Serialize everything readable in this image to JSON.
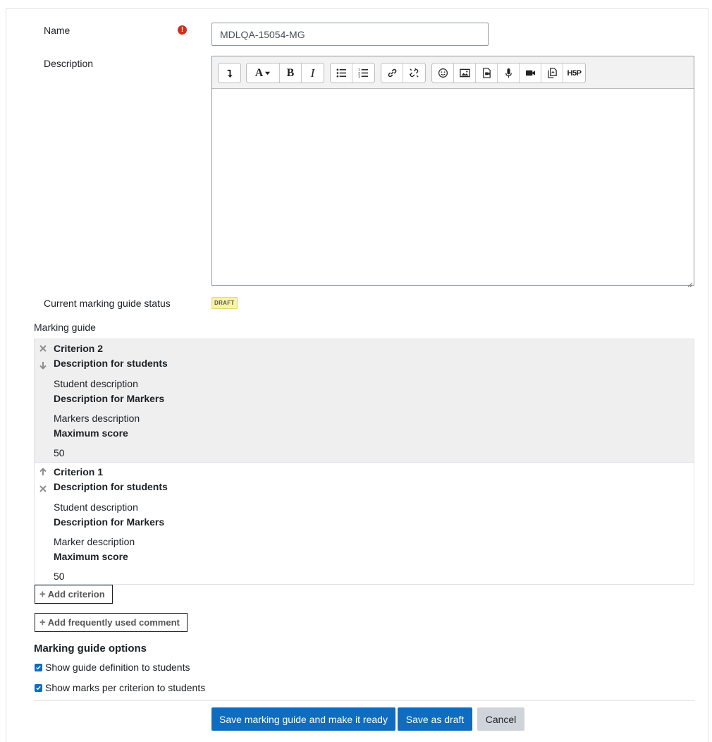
{
  "form": {
    "name_label": "Name",
    "name_value": "MDLQA-15054-MG",
    "description_label": "Description",
    "status_label": "Current marking guide status",
    "status_badge": "DRAFT"
  },
  "editor": {
    "toolbar_groups": [
      [
        "collapse-icon"
      ],
      [
        "font-icon",
        "bold-icon",
        "italic-icon"
      ],
      [
        "unordered-list-icon",
        "ordered-list-icon"
      ],
      [
        "link-icon",
        "unlink-icon"
      ],
      [
        "emoji-icon",
        "image-icon",
        "media-icon",
        "record-audio-icon",
        "record-video-icon",
        "manage-files-icon",
        "h5p-icon"
      ]
    ],
    "bold_glyph": "B",
    "italic_glyph": "I",
    "h5p_label": "H5P"
  },
  "marking_guide": {
    "label": "Marking guide",
    "criteria": [
      {
        "name": "Criterion 2",
        "desc_students_heading": "Description for students",
        "student_description": "Student description",
        "desc_markers_heading": "Description for Markers",
        "markers_description": "Markers description",
        "max_score_heading": "Maximum score",
        "max_score": "50"
      },
      {
        "name": "Criterion 1",
        "desc_students_heading": "Description for students",
        "student_description": "Student description",
        "desc_markers_heading": "Description for Markers",
        "markers_description": "Marker description",
        "max_score_heading": "Maximum score",
        "max_score": "50"
      }
    ],
    "add_criterion": "Add criterion",
    "add_comment": "Add frequently used comment"
  },
  "options": {
    "title": "Marking guide options",
    "show_definition": "Show guide definition to students",
    "show_marks": "Show marks per criterion to students"
  },
  "buttons": {
    "save_ready": "Save marking guide and make it ready",
    "save_draft": "Save as draft",
    "cancel": "Cancel"
  },
  "colors": {
    "primary": "#0f6cbf",
    "required": "#ca3120",
    "draft_badge": "#f9f59f"
  }
}
